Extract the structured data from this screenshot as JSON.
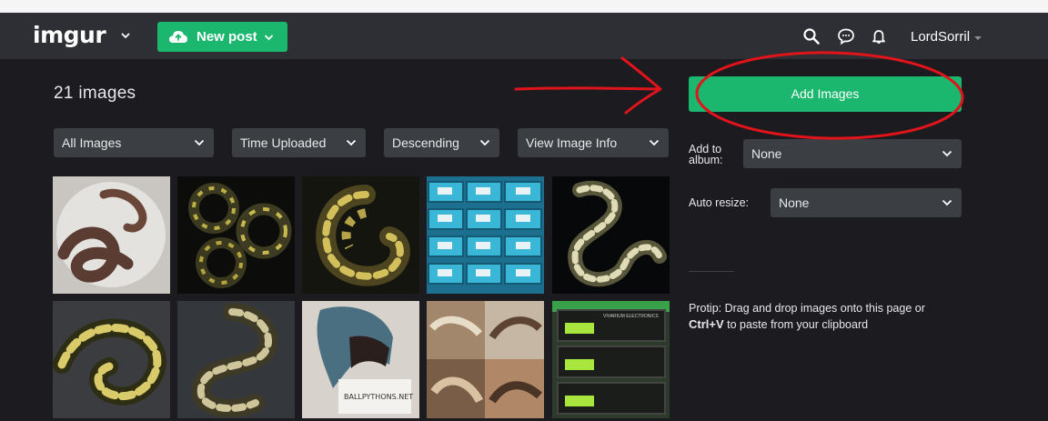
{
  "navbar": {
    "logo": "imgur",
    "new_post_label": "New post",
    "username": "LordSorril"
  },
  "gallery": {
    "count_label": "21 images",
    "filters": [
      {
        "label": "All Images"
      },
      {
        "label": "Time Uploaded"
      },
      {
        "label": "Descending"
      },
      {
        "label": "View Image Info"
      }
    ],
    "thumbnails": [
      {
        "subject": "brown snake in white bowl"
      },
      {
        "subject": "two dark ball pythons"
      },
      {
        "subject": "yellow patterned ball python"
      },
      {
        "subject": "blue reptile rack bins"
      },
      {
        "subject": "coiled pastel ball python"
      },
      {
        "subject": "yellow ball python"
      },
      {
        "subject": "patterned ball python"
      },
      {
        "subject": "raptor mask with sign",
        "sign_text": "BALLPYTHONS.NET"
      },
      {
        "subject": "collage of hatchling snakes"
      },
      {
        "subject": "green thermostat units",
        "unit_text": "VIVARIUM ELECTRONICS"
      }
    ]
  },
  "sidebar": {
    "add_images_label": "Add Images",
    "album_label": "Add to album:",
    "album_value": "None",
    "resize_label": "Auto resize:",
    "resize_value": "None",
    "protip_prefix": "Protip: Drag and drop images onto this page or",
    "protip_key": "Ctrl+V",
    "protip_suffix": " to paste from your clipboard"
  },
  "colors": {
    "accent_green": "#1bb76e",
    "navbar_bg": "#2d2f34",
    "page_bg": "#1b1b20",
    "select_bg": "#3b3e43",
    "annotation_red": "#e0141a"
  }
}
